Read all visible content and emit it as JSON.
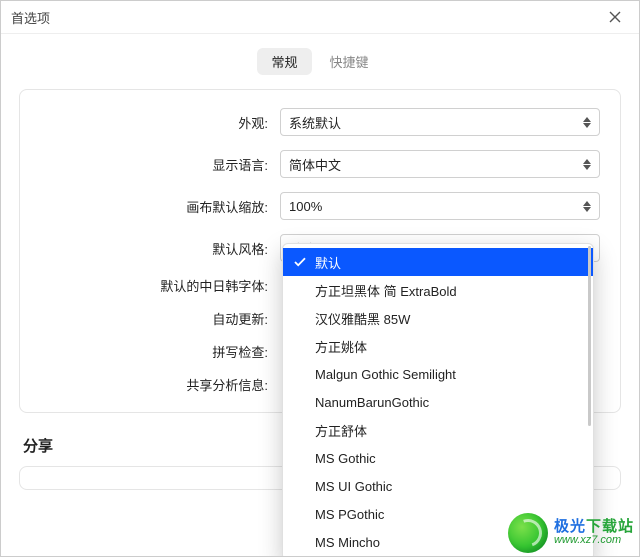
{
  "window": {
    "title": "首选项"
  },
  "tabs": {
    "general": "常规",
    "shortcuts": "快捷键"
  },
  "labels": {
    "appearance": "外观:",
    "language": "显示语言:",
    "default_zoom": "画布默认缩放:",
    "default_style": "默认风格:",
    "cjk_font": "默认的中日韩字体:",
    "auto_update": "自动更新:",
    "spell_check": "拼写检查:",
    "share_analytics": "共享分析信息:"
  },
  "values": {
    "appearance": "系统默认",
    "language": "简体中文",
    "default_zoom": "100%",
    "default_style": "默认"
  },
  "section": {
    "share": "分享"
  },
  "dropdown": {
    "items": [
      "默认",
      "方正坦黑体 简 ExtraBold",
      "汉仪雅酷黑 85W",
      "方正姚体",
      "Malgun Gothic Semilight",
      "NanumBarunGothic",
      "方正舒体",
      "MS Gothic",
      "MS UI Gothic",
      "MS PGothic",
      "MS Mincho"
    ],
    "selected_index": 0
  },
  "watermark": {
    "cn_prefix": "极光",
    "cn_suffix": "下载站",
    "url": "www.xz7.com"
  }
}
